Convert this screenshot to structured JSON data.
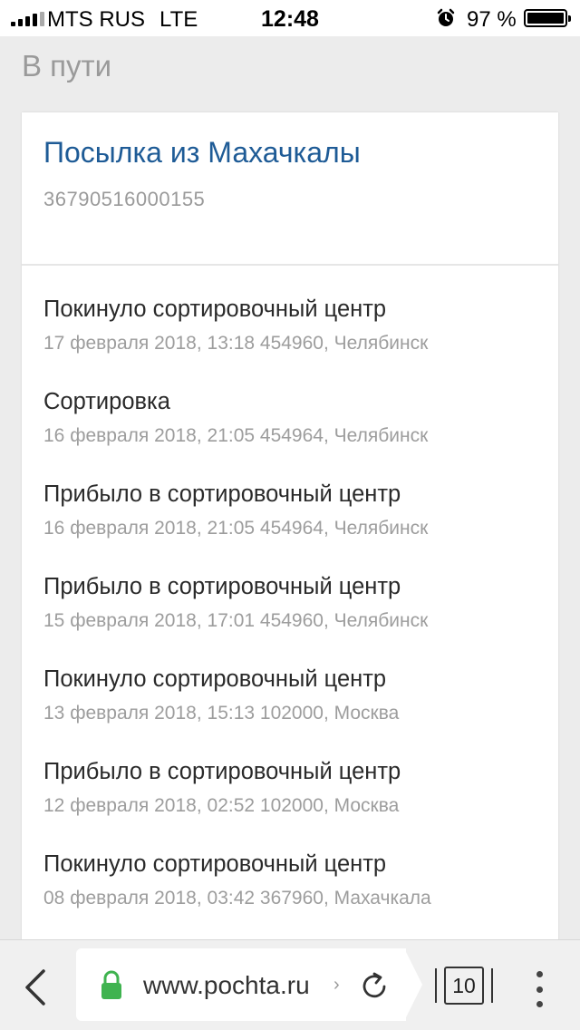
{
  "status_bar": {
    "carrier": "MTS RUS",
    "network": "LTE",
    "time": "12:48",
    "battery_percent": "97 %",
    "icons": [
      "signal-icon",
      "alarm-icon",
      "battery-icon"
    ]
  },
  "section": {
    "title": "В пути"
  },
  "parcel": {
    "title": "Посылка из Махачкалы",
    "tracking_number": "36790516000155"
  },
  "events": [
    {
      "title": "Покинуло сортировочный центр",
      "meta": "17 февраля 2018, 13:18 454960, Челябинск"
    },
    {
      "title": "Сортировка",
      "meta": "16 февраля 2018, 21:05 454964, Челябинск"
    },
    {
      "title": "Прибыло в сортировочный центр",
      "meta": "16 февраля 2018, 21:05 454964, Челябинск"
    },
    {
      "title": "Прибыло в сортировочный центр",
      "meta": "15 февраля 2018, 17:01 454960, Челябинск"
    },
    {
      "title": "Покинуло сортировочный центр",
      "meta": "13 февраля 2018, 15:13 102000, Москва"
    },
    {
      "title": "Прибыло в сортировочный центр",
      "meta": "12 февраля 2018, 02:52 102000, Москва"
    },
    {
      "title": "Покинуло сортировочный центр",
      "meta": "08 февраля 2018, 03:42 367960, Махачкала"
    }
  ],
  "browser": {
    "url": "www.pochta.ru",
    "url_chevron": "›",
    "tab_count": "10",
    "icons": [
      "back-arrow-icon",
      "lock-icon",
      "reload-icon",
      "tabs-icon",
      "more-menu-icon"
    ]
  },
  "colors": {
    "title_blue": "#1e5b96",
    "secure_green": "#3fb34f",
    "muted_gray": "#9d9d9d",
    "background": "#ececec"
  }
}
